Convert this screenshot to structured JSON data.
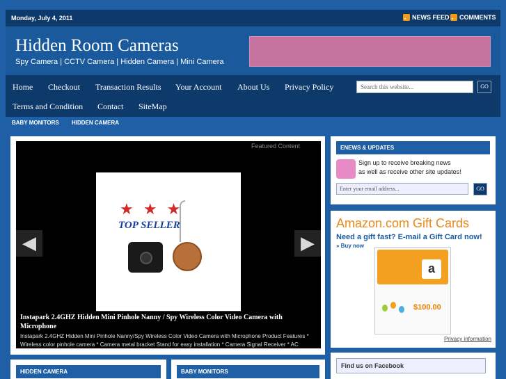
{
  "topbar": {
    "date": "Monday, July 4, 2011",
    "news_feed": "NEWS FEED",
    "comments": "COMMENTS"
  },
  "header": {
    "title": "Hidden Room Cameras",
    "description": "Spy Camera | CCTV Camera | Hidden Camera | Mini Camera"
  },
  "nav": {
    "items": [
      "Home",
      "Checkout",
      "Transaction Results",
      "Your Account",
      "About Us",
      "Privacy Policy",
      "Terms and Condition",
      "Contact",
      "SiteMap"
    ],
    "search_placeholder": "Search this website...",
    "go_label": "GO"
  },
  "subnav": {
    "items": [
      "BABY MONITORS",
      "HIDDEN CAMERA"
    ]
  },
  "featured": {
    "label": "Featured Content",
    "stars": "★ ★ ★",
    "badge": "TOP SELLER",
    "title": "Instapark 2.4GHZ Hidden Mini Pinhole Nanny / Spy Wireless Color Video Camera with Microphone",
    "excerpt": "Instapark 2.4GHZ Hidden Mini Pinhole Nanny/Spy Wireless Color Video Camera with Microphone Product Features * Wireless color pinhole camera * Camera metal bracket Stand for easy installation * Camera Signal Receiver * AC",
    "prev": "◀",
    "next": "▶"
  },
  "enews": {
    "title": "ENEWS & UPDATES",
    "text_line1": "Sign up to receive breaking news",
    "text_line2": "as well as receive other site updates!",
    "email_placeholder": "Enter your email address...",
    "go_label": "GO"
  },
  "amazon": {
    "title": "Amazon.com Gift Cards",
    "subtitle": "Need a gift fast?  E-mail a Gift Card now!",
    "buy_now": "» Buy now",
    "card_letter": "a",
    "price": "$100.00",
    "privacy": "Privacy information"
  },
  "bottom_widgets": {
    "left": "HIDDEN CAMERA",
    "middle": "BABY MONITORS",
    "facebook": "Find us on Facebook"
  },
  "colors": {
    "background": "#1f5fa6",
    "dark_bar": "#0e3a6b",
    "rss": "#f39a1a",
    "banner": "#c5729e"
  }
}
